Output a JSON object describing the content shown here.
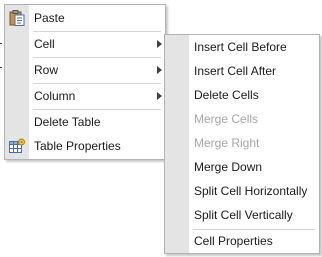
{
  "main_menu": {
    "items": [
      {
        "label": "Paste",
        "icon": "paste-icon"
      },
      {
        "label": "Cell",
        "submenu": true
      },
      {
        "label": "Row",
        "submenu": true
      },
      {
        "label": "Column",
        "submenu": true
      },
      {
        "label": "Delete Table"
      },
      {
        "label": "Table Properties",
        "icon": "table-properties-icon"
      }
    ]
  },
  "cell_submenu": {
    "items": [
      {
        "label": "Insert Cell Before",
        "enabled": true
      },
      {
        "label": "Insert Cell After",
        "enabled": true
      },
      {
        "label": "Delete Cells",
        "enabled": true
      },
      {
        "label": "Merge Cells",
        "enabled": false
      },
      {
        "label": "Merge Right",
        "enabled": false
      },
      {
        "label": "Merge Down",
        "enabled": true
      },
      {
        "label": "Split Cell Horizontally",
        "enabled": true
      },
      {
        "label": "Split Cell Vertically",
        "enabled": true
      },
      {
        "label": "Cell Properties",
        "enabled": true
      }
    ]
  },
  "colors": {
    "gutter": "#e4e4e4",
    "border": "#b2b2b2",
    "disabled_text": "#a6a6a6",
    "separator": "#d4d4d4"
  }
}
